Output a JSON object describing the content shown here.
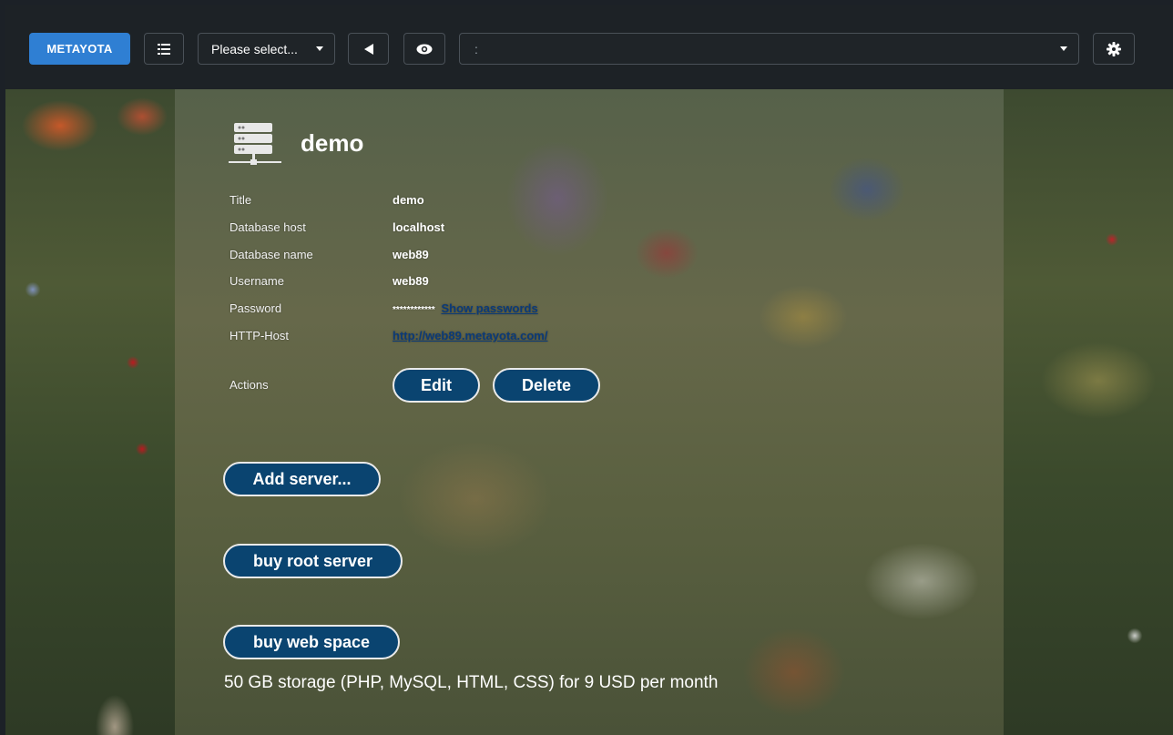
{
  "topbar": {
    "brand": "METAYOTA",
    "select_label": "Please select...",
    "path_value": ":",
    "icons": {
      "list": "list-icon",
      "back": "triangle-left-icon",
      "eye": "eye-icon",
      "settings": "gear-icon"
    }
  },
  "server": {
    "icon": "server-icon",
    "title": "demo",
    "fields": [
      {
        "label": "Title",
        "value": "demo"
      },
      {
        "label": "Database host",
        "value": "localhost"
      },
      {
        "label": "Database name",
        "value": "web89"
      },
      {
        "label": "Username",
        "value": "web89"
      },
      {
        "label": "Password",
        "value": "************",
        "link": "Show passwords"
      },
      {
        "label": "HTTP-Host",
        "link": "http://web89.metayota.com/"
      }
    ],
    "actions_label": "Actions",
    "edit_label": "Edit",
    "delete_label": "Delete"
  },
  "add_server_label": "Add server...",
  "buy_root_label": "buy root server",
  "buy_web_label": "buy web space",
  "web_space_note": "50 GB storage (PHP, MySQL, HTML, CSS) for 9 USD per month",
  "colors": {
    "brand": "#2f7fd3",
    "pill": "#0a4470",
    "link": "#0b3a78",
    "topbar": "#1d2226"
  }
}
